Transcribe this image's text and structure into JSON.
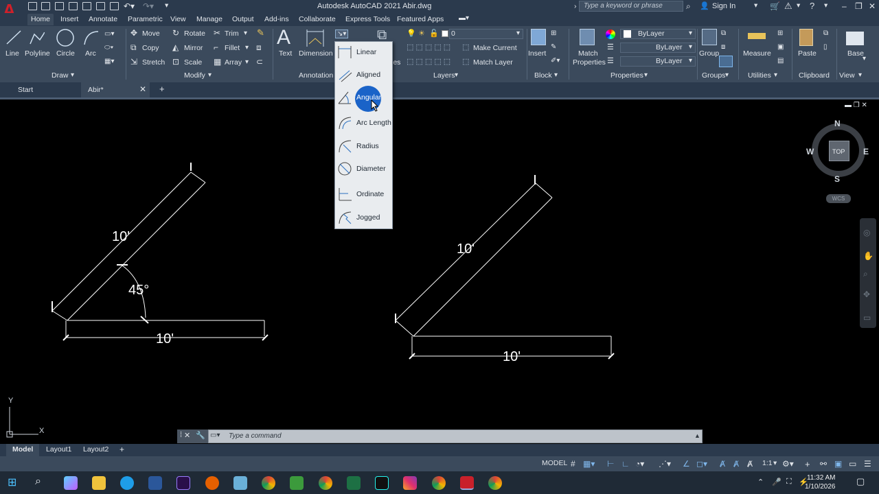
{
  "window": {
    "title": "Autodesk AutoCAD 2021   Abir.dwg",
    "search_placeholder": "Type a keyword or phrase",
    "sign_in": "Sign In"
  },
  "menu": [
    "Home",
    "Insert",
    "Annotate",
    "Parametric",
    "View",
    "Manage",
    "Output",
    "Add-ins",
    "Collaborate",
    "Express Tools",
    "Featured Apps"
  ],
  "ribbon": {
    "draw": {
      "line": "Line",
      "polyline": "Polyline",
      "circle": "Circle",
      "arc": "Arc",
      "panel": "Draw"
    },
    "modify": {
      "move": "Move",
      "rotate": "Rotate",
      "trim": "Trim",
      "copy": "Copy",
      "mirror": "Mirror",
      "fillet": "Fillet",
      "stretch": "Stretch",
      "scale": "Scale",
      "array": "Array",
      "panel": "Modify"
    },
    "annotation": {
      "text": "Text",
      "dimension": "Dimension",
      "panel": "Annotation"
    },
    "layers": {
      "layer_value": "0",
      "make_current": "Make Current",
      "match_layer": "Match Layer",
      "panel": "Layers",
      "partial_label": "ies"
    },
    "block": {
      "insert": "Insert",
      "panel": "Block"
    },
    "properties": {
      "match": "Match",
      "match2": "Properties",
      "bylayer1": "ByLayer",
      "bylayer2": "ByLayer",
      "bylayer3": "ByLayer",
      "panel": "Properties"
    },
    "groups": {
      "group": "Group",
      "panel": "Groups"
    },
    "utilities": {
      "measure": "Measure",
      "panel": "Utilities"
    },
    "clipboard": {
      "paste": "Paste",
      "panel": "Clipboard"
    },
    "view": {
      "base": "Base",
      "panel": "View"
    }
  },
  "dimension_menu": [
    "Linear",
    "Aligned",
    "Angular",
    "Arc Length",
    "Radius",
    "Diameter",
    "Ordinate",
    "Jogged"
  ],
  "doc_tabs": {
    "start": "Start",
    "active": "Abir*"
  },
  "viewcube": {
    "n": "N",
    "s": "S",
    "e": "E",
    "w": "W",
    "top": "TOP",
    "wcs": "WCS"
  },
  "drawing": {
    "left_len": "10'",
    "left_angle": "45°",
    "left_base": "10'",
    "right_len": "10'",
    "right_base": "10'"
  },
  "ucs": {
    "y": "Y",
    "x": "X"
  },
  "command": {
    "placeholder": "Type a command"
  },
  "layouts": {
    "model": "Model",
    "layout1": "Layout1",
    "layout2": "Layout2"
  },
  "status": {
    "model": "MODEL",
    "scale": "1:1"
  },
  "clock": {
    "time": "11:32 AM",
    "date": "1/10/2026"
  }
}
